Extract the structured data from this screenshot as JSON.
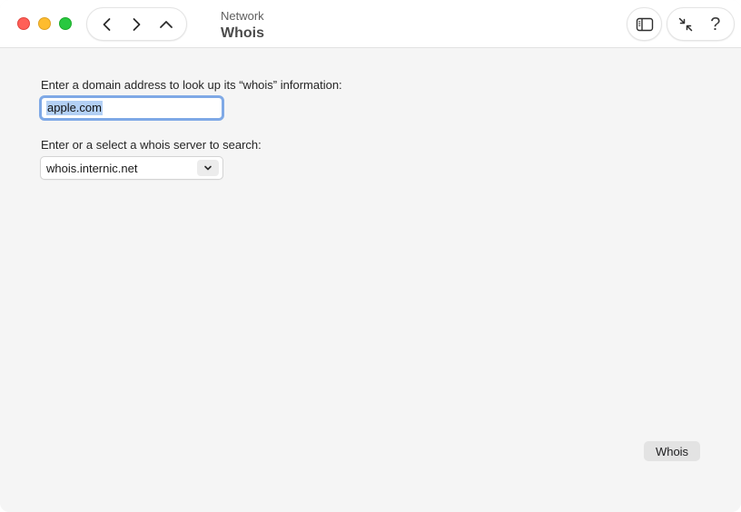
{
  "window": {
    "section": "Network",
    "title": "Whois"
  },
  "toolbar": {
    "back_icon": "chevron-left-icon",
    "forward_icon": "chevron-right-icon",
    "up_icon": "chevron-up-icon",
    "sidebar_icon": "sidebar-toggle-icon",
    "collapse_icon": "arrows-collapse-icon",
    "help_label": "?"
  },
  "form": {
    "domain_label": "Enter a domain address to look up its “whois” information:",
    "domain_value": "apple.com",
    "server_label": "Enter or a select a whois server to search:",
    "server_value": "whois.internic.net"
  },
  "actions": {
    "whois_label": "Whois"
  },
  "colors": {
    "close": "#ff5f57",
    "minimize": "#febc2e",
    "maximize": "#28c840",
    "focus_ring": "#7fa9e6",
    "selection": "#b3d0f5"
  }
}
